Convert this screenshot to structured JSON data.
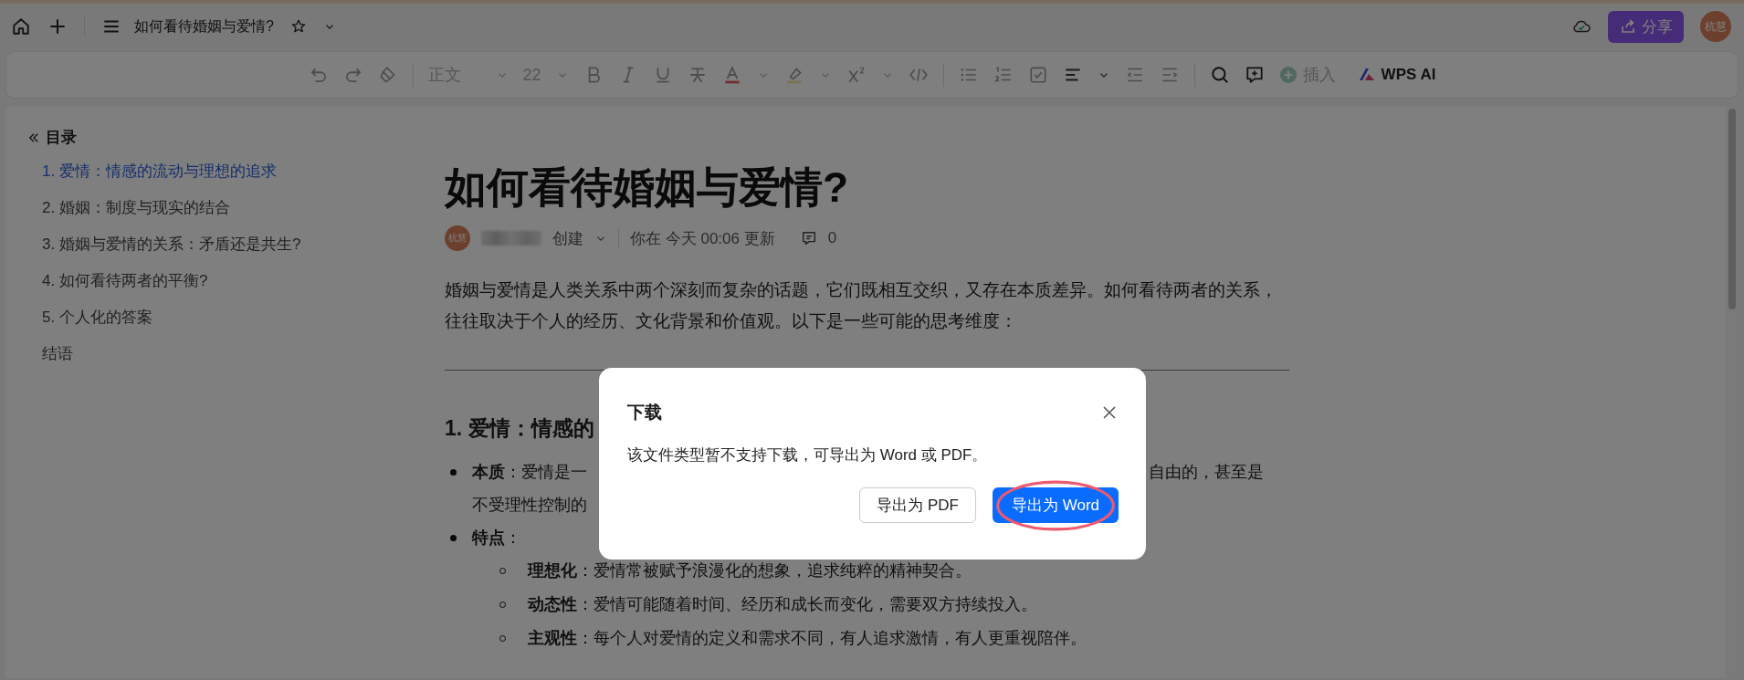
{
  "top_bar": {
    "doc_title": "如何看待婚姻与爱情?",
    "share_button": "分享",
    "avatar": "杭慧"
  },
  "toolbar": {
    "style": "正文",
    "font_size": "22",
    "insert": "插入",
    "ai": "WPS AI"
  },
  "outline": {
    "title": "目录",
    "items": [
      {
        "label": "1. 爱情：情感的流动与理想的追求",
        "selected": true
      },
      {
        "label": "2. 婚姻：制度与现实的结合",
        "selected": false
      },
      {
        "label": "3. 婚姻与爱情的关系：矛盾还是共生?",
        "selected": false
      },
      {
        "label": "4. 如何看待两者的平衡?",
        "selected": false
      },
      {
        "label": "5. 个人化的答案",
        "selected": false
      },
      {
        "label": "结语",
        "selected": false
      }
    ]
  },
  "document": {
    "title": "如何看待婚姻与爱情?",
    "meta": {
      "avatar": "杭慧",
      "created": "创建",
      "updated": "你在 今天 00:06 更新",
      "comments": "0"
    },
    "intro": "婚姻与爱情是人类关系中两个深刻而复杂的话题，它们既相互交织，又存在本质差异。如何看待两者的关系，往往取决于个人的经历、文化背景和价值观。以下是一些可能的思考维度：",
    "section_heading": "1. 爱情：情感的",
    "bullets": [
      {
        "text": "**本质**：爱情是一",
        "text_right": "自由的，甚至是",
        "continuation": "不受理性控制的"
      },
      {
        "text": "**特点**：",
        "children": [
          {
            "text": "**理想化**：爱情常被赋予浪漫化的想象，追求纯粹的精神契合。"
          },
          {
            "text": "**动态性**：爱情可能随着时间、经历和成长而变化，需要双方持续投入。"
          },
          {
            "text": "**主观性**：每个人对爱情的定义和需求不同，有人追求激情，有人更重视陪伴。"
          }
        ]
      }
    ]
  },
  "dialog": {
    "title": "下载",
    "message": "该文件类型暂不支持下载，可导出为 Word 或 PDF。",
    "buttons": [
      {
        "label": "导出为 PDF",
        "kind": "secondary",
        "highlighted": false
      },
      {
        "label": "导出为 Word",
        "kind": "primary",
        "highlighted": true
      }
    ]
  }
}
